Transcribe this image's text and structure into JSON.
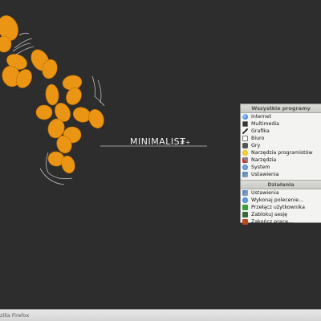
{
  "wallpaper": {
    "logo_text": "MINIMALIST",
    "logo_suffix": "#+",
    "accent_color": "#f19a14",
    "background_color": "#2d2d2d"
  },
  "menu": {
    "all_programs_header": "Wszystkie programy",
    "programs": [
      {
        "label": "Internet",
        "icon": "globe-icon"
      },
      {
        "label": "Multimedia",
        "icon": "film-icon"
      },
      {
        "label": "Grafika",
        "icon": "brush-icon"
      },
      {
        "label": "Biuro",
        "icon": "document-icon"
      },
      {
        "label": "Gry",
        "icon": "gamepad-icon"
      },
      {
        "label": "Narzędzia programistów",
        "icon": "smiley-icon"
      },
      {
        "label": "Narzędzia",
        "icon": "tools-icon"
      },
      {
        "label": "System",
        "icon": "system-icon"
      },
      {
        "label": "Ustawienia",
        "icon": "settings-icon"
      }
    ],
    "actions_header": "Działania",
    "actions": [
      {
        "label": "Ustawienia",
        "icon": "settings-icon"
      },
      {
        "label": "Wykonaj polecenie...",
        "icon": "run-icon"
      },
      {
        "label": "Przełącz użytkownika",
        "icon": "switch-user-icon"
      },
      {
        "label": "Zablokuj sesję",
        "icon": "lock-icon"
      },
      {
        "label": "Zakończ pracę...",
        "icon": "shutdown-icon"
      }
    ]
  },
  "taskbar": {
    "task_label": "zilla Firefox"
  }
}
